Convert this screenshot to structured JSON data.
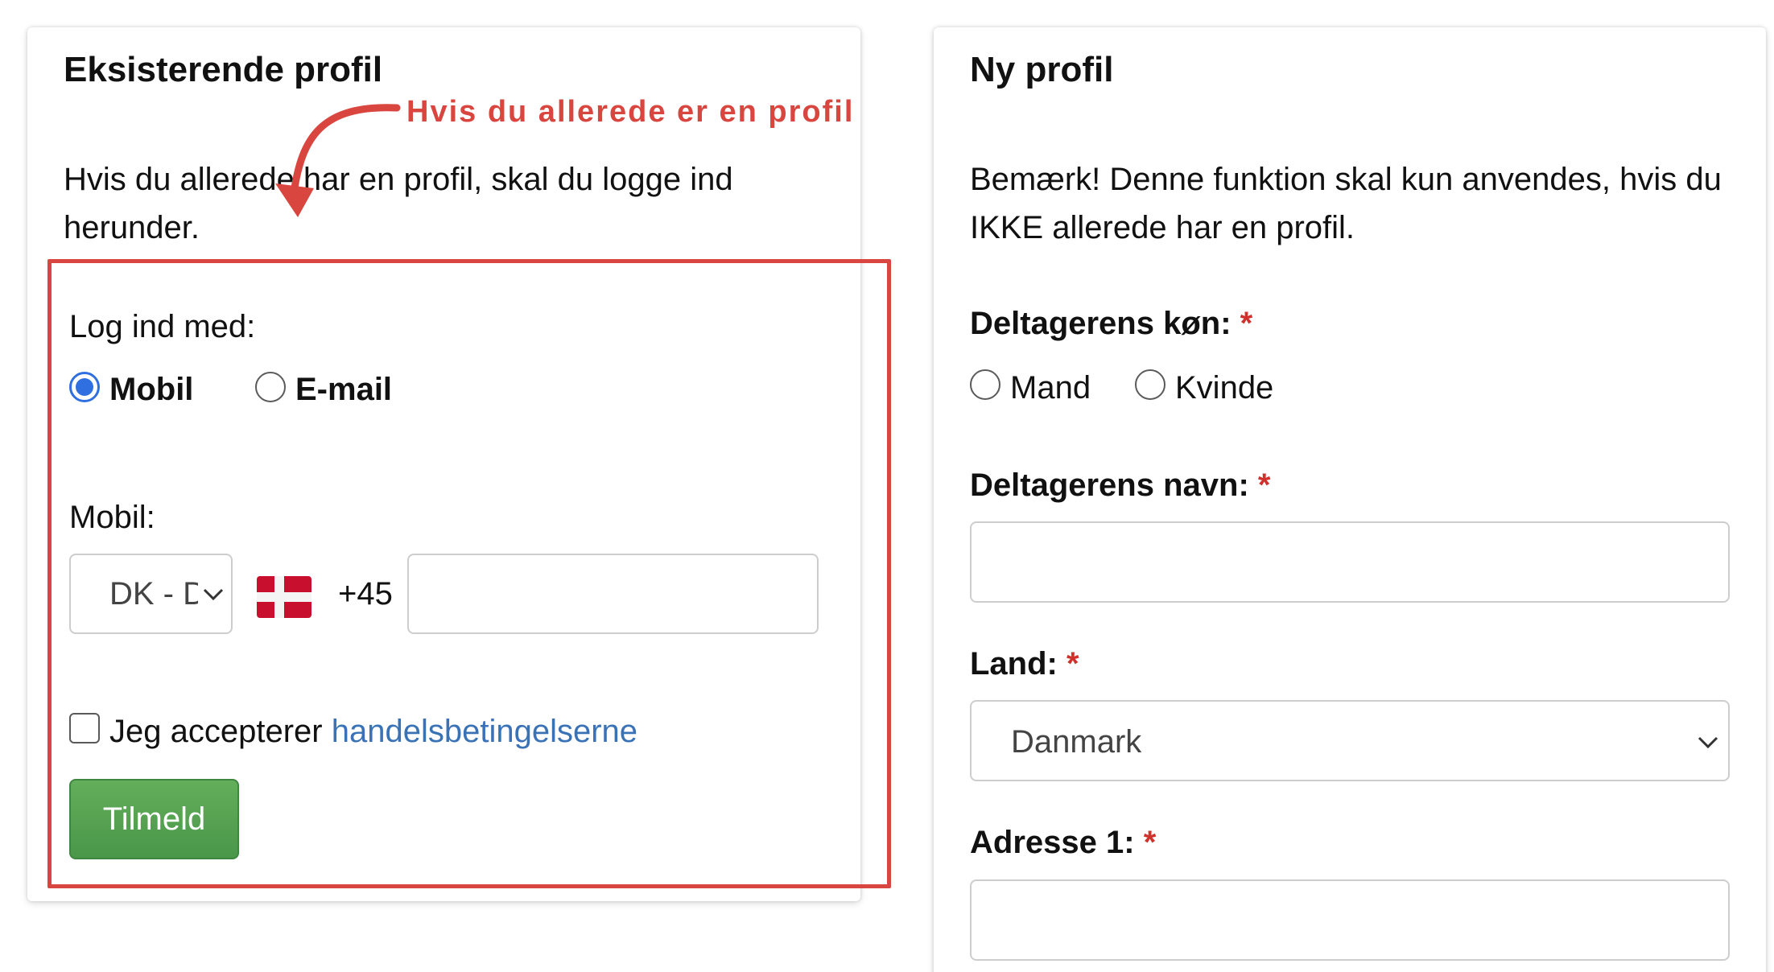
{
  "existing": {
    "title": "Eksisterende profil",
    "intro": "Hvis du allerede har en profil, skal du logge ind herunder.",
    "login_with_label": "Log ind med:",
    "radio_mobile": "Mobil",
    "radio_email": "E-mail",
    "mobile_label": "Mobil:",
    "country_code_select": "DK - D",
    "dial_code": "+45",
    "accept_text": "Jeg accepterer",
    "terms_link": "handelsbetingelserne",
    "submit_button": "Tilmeld"
  },
  "annotation": {
    "text": "Hvis du allerede er en profil",
    "color": "#d9463f"
  },
  "new_profile": {
    "title": "Ny profil",
    "notice": "Bemærk! Denne funktion skal kun anvendes, hvis du IKKE allerede har en profil.",
    "gender_label": "Deltagerens køn:",
    "gender_male": "Mand",
    "gender_female": "Kvinde",
    "name_label": "Deltagerens navn:",
    "country_label": "Land:",
    "country_value": "Danmark",
    "address_label": "Adresse 1:",
    "required_mark": "*"
  },
  "colors": {
    "accent_blue": "#2f6fe0",
    "link_blue": "#3a72b6",
    "button_green": "#4a974a",
    "required_red": "#d0312d"
  }
}
